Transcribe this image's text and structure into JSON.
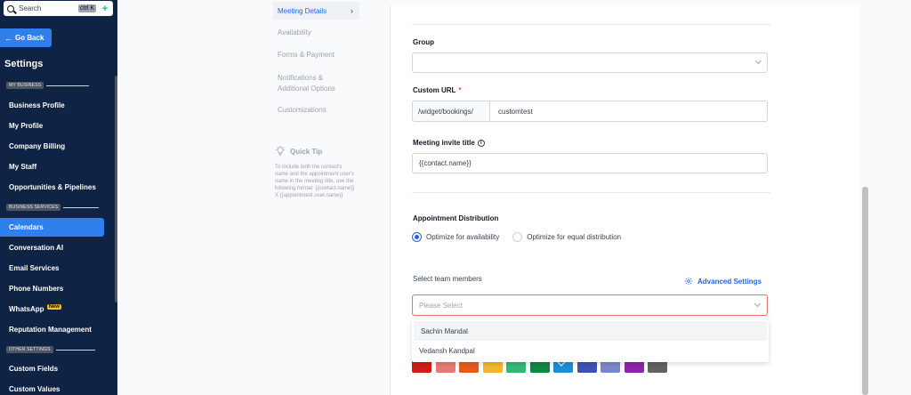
{
  "sidebar": {
    "search_placeholder": "Search",
    "search_shortcut": "ctrl K",
    "go_back": "Go Back",
    "title": "Settings",
    "sections": {
      "my_business": "MY BUSINESS",
      "business_services": "BUSINESS SERVICES",
      "other_settings": "OTHER SETTINGS"
    },
    "items": [
      {
        "label": "Business Profile"
      },
      {
        "label": "My Profile"
      },
      {
        "label": "Company Billing"
      },
      {
        "label": "My Staff"
      },
      {
        "label": "Opportunities & Pipelines"
      },
      {
        "label": "Calendars",
        "active": true
      },
      {
        "label": "Conversation AI"
      },
      {
        "label": "Email Services"
      },
      {
        "label": "Phone Numbers"
      },
      {
        "label": "WhatsApp",
        "badge": "New"
      },
      {
        "label": "Reputation Management"
      },
      {
        "label": "Custom Fields"
      },
      {
        "label": "Custom Values"
      }
    ]
  },
  "steps": [
    {
      "label": "Meeting Details",
      "active": true
    },
    {
      "label": "Availability"
    },
    {
      "label": "Forms & Payment"
    },
    {
      "label": "Notifications & Additional Options"
    },
    {
      "label": "Customizations"
    }
  ],
  "tip": {
    "title": "Quick Tip",
    "body": "To include both the contact's name and the appointment user's name in the meeting title, use the following format: {{contact.name}} X {{appointment.user.name}}"
  },
  "form": {
    "group_label": "Group",
    "group_value": "",
    "custom_url_label": "Custom URL",
    "required_mark": "*",
    "custom_url_prefix": "/widget/bookings/",
    "custom_url_value": "customtest",
    "invite_title_label": "Meeting invite title",
    "invite_title_value": "{{contact.name}}",
    "distribution_label": "Appointment Distribution",
    "distribution_options": [
      {
        "label": "Optimize for availability",
        "selected": true
      },
      {
        "label": "Optimize for equal distribution",
        "selected": false
      }
    ],
    "team_label": "Select team members",
    "advanced_settings": "Advanced Settings",
    "team_placeholder": "Please Select",
    "team_options": [
      "Sachin Mandal",
      "Vedansh Kandpal"
    ],
    "colors": [
      "#cc1f1a",
      "#e57b72",
      "#e8591f",
      "#f0b72f",
      "#34b57a",
      "#118746",
      "#1a8fd8",
      "#3f51b5",
      "#7b86c9",
      "#8e24aa",
      "#616161"
    ],
    "selected_color_index": 6
  }
}
